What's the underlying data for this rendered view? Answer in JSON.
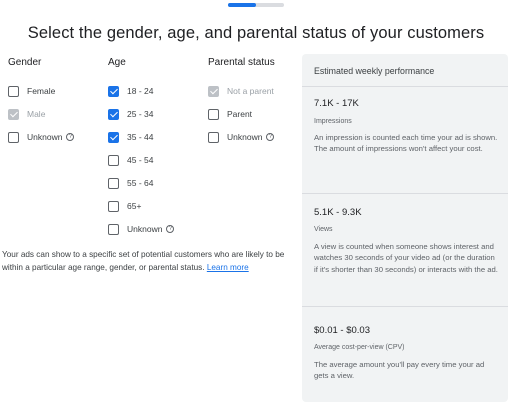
{
  "progress": {
    "fraction": 0.5
  },
  "title": "Select the gender, age, and parental status of your customers",
  "gender": {
    "heading": "Gender",
    "options": [
      {
        "label": "Female",
        "checked": false,
        "disabled": false,
        "help": false
      },
      {
        "label": "Male",
        "checked": true,
        "disabled": true,
        "help": false
      },
      {
        "label": "Unknown",
        "checked": false,
        "disabled": false,
        "help": true
      }
    ]
  },
  "age": {
    "heading": "Age",
    "options": [
      {
        "label": "18 - 24",
        "checked": true,
        "disabled": false,
        "help": false
      },
      {
        "label": "25 - 34",
        "checked": true,
        "disabled": false,
        "help": false
      },
      {
        "label": "35 - 44",
        "checked": true,
        "disabled": false,
        "help": false
      },
      {
        "label": "45 - 54",
        "checked": false,
        "disabled": false,
        "help": false
      },
      {
        "label": "55 - 64",
        "checked": false,
        "disabled": false,
        "help": false
      },
      {
        "label": "65+",
        "checked": false,
        "disabled": false,
        "help": false
      },
      {
        "label": "Unknown",
        "checked": false,
        "disabled": false,
        "help": true
      }
    ]
  },
  "parental": {
    "heading": "Parental status",
    "options": [
      {
        "label": "Not a parent",
        "checked": true,
        "disabled": true,
        "help": false
      },
      {
        "label": "Parent",
        "checked": false,
        "disabled": false,
        "help": false
      },
      {
        "label": "Unknown",
        "checked": false,
        "disabled": false,
        "help": true
      }
    ]
  },
  "footer": {
    "text": "Your ads can show to a specific set of potential customers who are likely to be within a particular age range, gender, or parental status.",
    "link": "Learn more"
  },
  "panel": {
    "heading": "Estimated weekly performance",
    "metrics": [
      {
        "value": "7.1K - 17K",
        "label": "Impressions",
        "description": "An impression is counted each time your ad is shown. The amount of impressions won't affect your cost."
      },
      {
        "value": "5.1K - 9.3K",
        "label": "Views",
        "description": "A view is counted when someone shows interest and watches 30 seconds of your video ad (or the duration if it's shorter than 30 seconds) or interacts with the ad."
      },
      {
        "value": "$0.01 - $0.03",
        "label": "Average cost-per-view (CPV)",
        "description": "The average amount you'll pay every time your ad gets a view."
      }
    ]
  },
  "colors": {
    "accent": "#1a73e8",
    "panel_bg": "#f1f3f4",
    "disabled": "#bdc1c6"
  },
  "icons": {
    "help": "help-circle-icon",
    "check": "checkmark-icon"
  }
}
